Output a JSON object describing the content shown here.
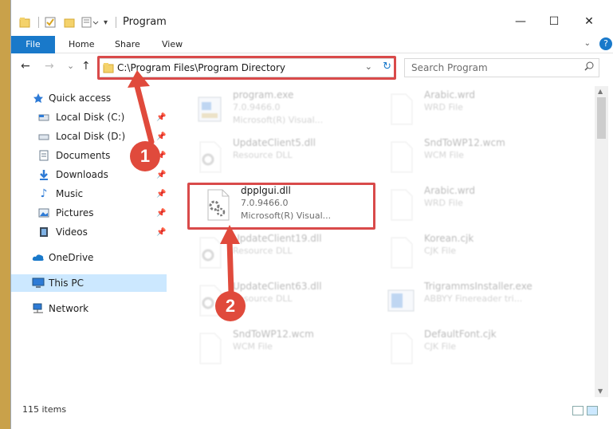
{
  "window": {
    "title": "Program",
    "minimize": "—",
    "maximize": "☐",
    "close": "✕"
  },
  "ribbon": {
    "tabs": [
      "File",
      "Home",
      "Share",
      "View"
    ],
    "help": "?"
  },
  "nav": {
    "back": "←",
    "forward": "→",
    "recent": "⌄",
    "up": "↑",
    "address": "C:\\Program Files\\Program Directory",
    "search_placeholder": "Search Program"
  },
  "sidebar": {
    "items": [
      {
        "label": "Quick access",
        "icon": "star-icon"
      },
      {
        "label": "Local Disk (C:)",
        "icon": "drive-icon"
      },
      {
        "label": "Local Disk (D:)",
        "icon": "drive-icon"
      },
      {
        "label": "Documents",
        "icon": "documents-icon"
      },
      {
        "label": "Downloads",
        "icon": "download-icon"
      },
      {
        "label": "Music",
        "icon": "music-icon"
      },
      {
        "label": "Pictures",
        "icon": "pictures-icon"
      },
      {
        "label": "Videos",
        "icon": "videos-icon"
      },
      {
        "label": "OneDrive",
        "icon": "cloud-icon"
      },
      {
        "label": "This PC",
        "icon": "computer-icon"
      },
      {
        "label": "Network",
        "icon": "network-icon"
      }
    ]
  },
  "files": [
    {
      "name": "program.exe",
      "line1": "7.0.9466.0",
      "line2": "Microsoft(R) Visual..."
    },
    {
      "name": "Arabic.wrd",
      "line1": "WRD File",
      "line2": ""
    },
    {
      "name": "UpdateClient5.dll",
      "line1": "Resource DLL",
      "line2": ""
    },
    {
      "name": "SndToWP12.wcm",
      "line1": "WCM File",
      "line2": ""
    },
    {
      "name": "dpplgui.dll",
      "line1": "7.0.9466.0",
      "line2": "Microsoft(R) Visual..."
    },
    {
      "name": "Arabic.wrd",
      "line1": "WRD File",
      "line2": ""
    },
    {
      "name": "UpdateClient19.dll",
      "line1": "Resource DLL",
      "line2": ""
    },
    {
      "name": "Korean.cjk",
      "line1": "CJK File",
      "line2": ""
    },
    {
      "name": "UpdateClient63.dll",
      "line1": "Resource DLL",
      "line2": ""
    },
    {
      "name": "TrigrammsInstaller.exe",
      "line1": "ABBYY Finereader tri...",
      "line2": ""
    },
    {
      "name": "SndToWP12.wcm",
      "line1": "WCM File",
      "line2": ""
    },
    {
      "name": "DefaultFont.cjk",
      "line1": "CJK File",
      "line2": ""
    }
  ],
  "status": {
    "count": "115 items"
  },
  "annotations": {
    "step1": "1",
    "step2": "2"
  },
  "colors": {
    "accent": "#1979ca",
    "highlight": "#d94a4a",
    "badge": "#e04a3c",
    "selected": "#cce8ff"
  }
}
